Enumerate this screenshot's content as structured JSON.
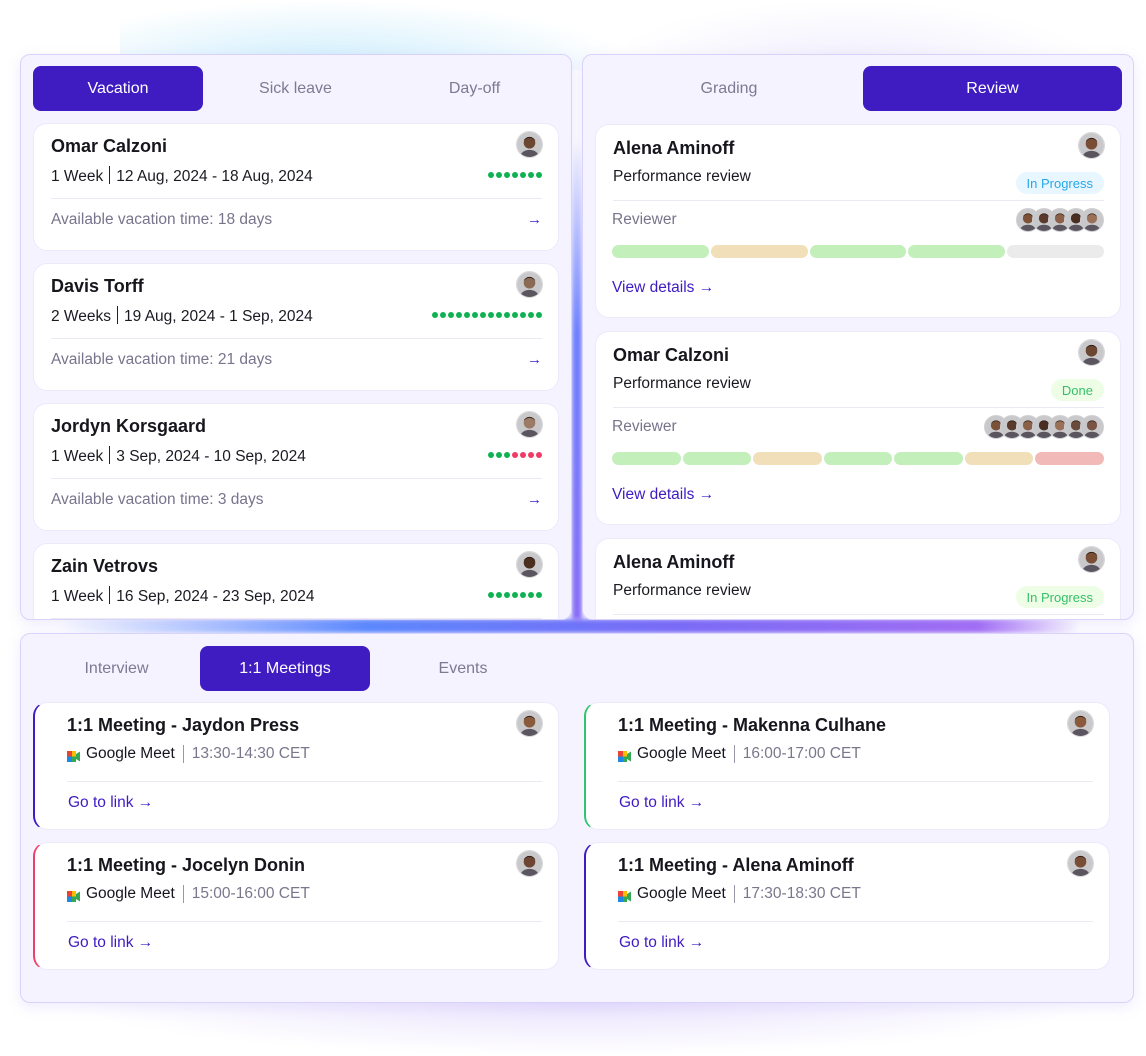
{
  "leave_panel": {
    "tabs": [
      {
        "label": "Vacation",
        "active": true
      },
      {
        "label": "Sick leave",
        "active": false
      },
      {
        "label": "Day-off",
        "active": false
      }
    ],
    "entries": [
      {
        "name": "Omar Calzoni",
        "duration": "1 Week",
        "range": "12 Aug, 2024 - 18 Aug, 2024",
        "available": "Available vacation time: 18 days",
        "dots": [
          "green",
          "green",
          "green",
          "green",
          "green",
          "green",
          "green"
        ],
        "avatar_tone": "#6b4630"
      },
      {
        "name": "Davis Torff",
        "duration": "2 Weeks",
        "range": "19 Aug, 2024 - 1 Sep, 2024",
        "available": "Available vacation time: 21 days",
        "dots": [
          "green",
          "green",
          "green",
          "green",
          "green",
          "green",
          "green",
          "green",
          "green",
          "green",
          "green",
          "green",
          "green",
          "green"
        ],
        "avatar_tone": "#8a6a55"
      },
      {
        "name": "Jordyn Korsgaard",
        "duration": "1 Week",
        "range": "3 Sep, 2024 - 10 Sep, 2024",
        "available": "Available vacation time: 3 days",
        "dots": [
          "green",
          "green",
          "green",
          "red",
          "red",
          "red",
          "red"
        ],
        "avatar_tone": "#9b7a66"
      },
      {
        "name": "Zain Vetrovs",
        "duration": "1 Week",
        "range": "16 Sep, 2024 - 23 Sep, 2024",
        "available": "",
        "dots": [
          "green",
          "green",
          "green",
          "green",
          "green",
          "green",
          "green"
        ],
        "avatar_tone": "#4a2e20"
      }
    ],
    "arrow": "→"
  },
  "review_panel": {
    "tabs": [
      {
        "label": "Grading",
        "active": false
      },
      {
        "label": "Review",
        "active": true
      }
    ],
    "reviews": [
      {
        "name": "Alena Aminoff",
        "type": "Performance review",
        "status": "In Progress",
        "status_style": "blue",
        "reviewer_label": "Reviewer",
        "reviewer_count": 5,
        "segments": [
          "green",
          "tan",
          "green",
          "green",
          "gray"
        ],
        "link": "View details →",
        "avatar_tone": "#7a4d35"
      },
      {
        "name": "Omar Calzoni",
        "type": "Performance review",
        "status": "Done",
        "status_style": "green",
        "reviewer_label": "Reviewer",
        "reviewer_count": 7,
        "segments": [
          "green",
          "green",
          "tan",
          "green",
          "green",
          "tan",
          "red"
        ],
        "link": "View details →",
        "avatar_tone": "#6b4630"
      },
      {
        "name": "Alena Aminoff",
        "type": "Performance review",
        "status": "In Progress",
        "status_style": "green",
        "avatar_tone": "#7a4d35"
      }
    ]
  },
  "meetings_panel": {
    "tabs": [
      {
        "label": "Interview",
        "active": false
      },
      {
        "label": "1:1 Meetings",
        "active": true
      },
      {
        "label": "Events",
        "active": false
      }
    ],
    "meetings": [
      {
        "title": "1:1 Meeting - Jaydon Press",
        "platform": "Google Meet",
        "time": "13:30-14:30 CET",
        "link": "Go to link →",
        "accent": "#3f1bc2",
        "avatar_tone": "#8a5a3c"
      },
      {
        "title": "1:1 Meeting - Makenna Culhane",
        "platform": "Google Meet",
        "time": "16:00-17:00 CET",
        "link": "Go to link →",
        "accent": "#2fc46f",
        "avatar_tone": "#8b5a3d"
      },
      {
        "title": "1:1 Meeting - Jocelyn Donin",
        "platform": "Google Meet",
        "time": "15:00-16:00 CET",
        "link": "Go to link →",
        "accent": "#ef3f68",
        "avatar_tone": "#6e4532"
      },
      {
        "title": "1:1 Meeting - Alena Aminoff",
        "platform": "Google Meet",
        "time": "17:30-18:30 CET",
        "link": "Go to link →",
        "accent": "#3f1bc2",
        "avatar_tone": "#7a4d35"
      }
    ]
  },
  "colors": {
    "accent": "#3f1bc2",
    "dot_green": "#0fb252",
    "dot_red": "#f03b66",
    "seg_green": "#c3efba",
    "seg_tan": "#f0dfb9",
    "seg_gray": "#ebebeb",
    "seg_red": "#f2b9b9",
    "badge_blue_bg": "#e8f6ff",
    "badge_blue_fg": "#28a9e6",
    "badge_green_bg": "#eefde6",
    "badge_green_fg": "#36c06a"
  }
}
